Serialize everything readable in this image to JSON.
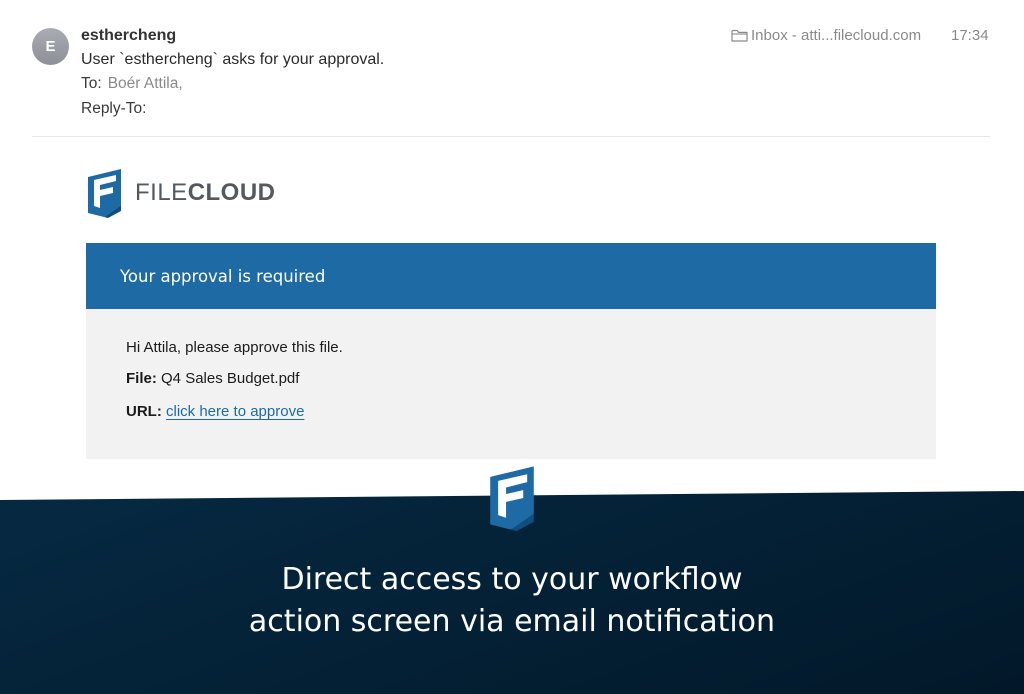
{
  "email": {
    "avatar_initial": "E",
    "sender": "esthercheng",
    "subject": "User `esthercheng` asks for your approval.",
    "to_label": "To:",
    "to_value": "Boér Attila,",
    "reply_to_label": "Reply-To:",
    "mailbox": "Inbox - atti...filecloud.com",
    "time": "17:34"
  },
  "body": {
    "logo": {
      "word_light": "FILE",
      "word_bold": "CLOUD"
    },
    "banner_title": "Your approval is required",
    "greeting": "Hi Attila, please approve this file.",
    "file_label": "File:",
    "file_name": "Q4 Sales Budget.pdf",
    "url_label": "URL:",
    "url_link_text": "click here to approve"
  },
  "footer": {
    "tagline_line1": "Direct access to your workflow",
    "tagline_line2": "action screen via email notification"
  },
  "colors": {
    "brand_blue": "#1d6aa5",
    "footer_dark": "#062a43",
    "muted_text": "#8a8a8a"
  },
  "icons": [
    "folder-icon",
    "filecloud-logo-icon"
  ]
}
